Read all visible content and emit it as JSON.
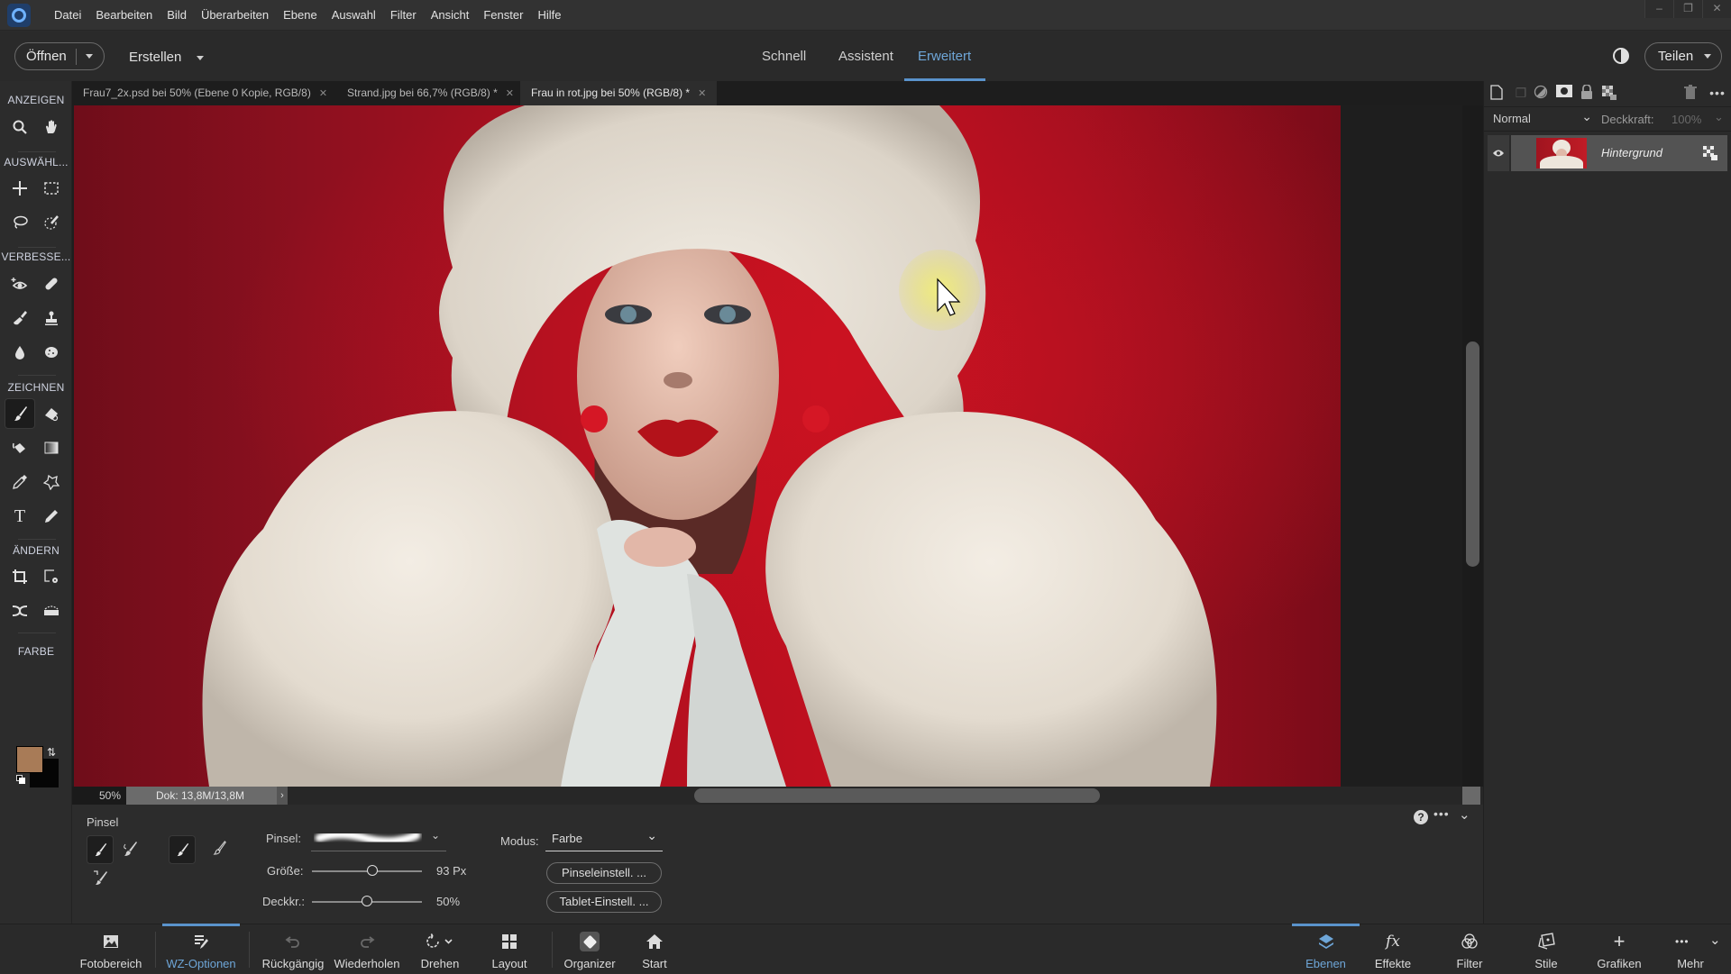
{
  "menu": {
    "items": [
      "Datei",
      "Bearbeiten",
      "Bild",
      "Überarbeiten",
      "Ebene",
      "Auswahl",
      "Filter",
      "Ansicht",
      "Fenster",
      "Hilfe"
    ],
    "window_controls": {
      "minimize": "–",
      "restore": "❐",
      "close": "✕"
    }
  },
  "topbar": {
    "open_label": "Öffnen",
    "create_label": "Erstellen",
    "modes": [
      "Schnell",
      "Assistent",
      "Erweitert"
    ],
    "active_mode": "Erweitert",
    "share_label": "Teilen"
  },
  "tabs": [
    {
      "label": "Frau7_2x.psd bei 50% (Ebene 0 Kopie, RGB/8)",
      "active": false
    },
    {
      "label": "Strand.jpg bei 66,7% (RGB/8) *",
      "active": false
    },
    {
      "label": "Frau in rot.jpg bei 50% (RGB/8) *",
      "active": true
    }
  ],
  "tools": {
    "sections": [
      "ANZEIGEN",
      "AUSWÄHL...",
      "VERBESSE...",
      "ZEICHNEN",
      "ÄNDERN",
      "FARBE"
    ],
    "items": [
      "zoom-tool",
      "hand-tool",
      "move-tool",
      "marquee-tool",
      "lasso-tool",
      "quick-selection-tool",
      "red-eye-tool",
      "spot-healing-tool",
      "smart-brush-tool",
      "clone-stamp-tool",
      "blur-tool",
      "sponge-tool",
      "brush-tool",
      "eraser-tool",
      "paint-bucket-tool",
      "gradient-tool",
      "eyedropper-tool",
      "custom-shape-tool",
      "type-tool",
      "pencil-tool",
      "crop-tool",
      "recompose-tool",
      "content-aware-move-tool",
      "straighten-tool"
    ],
    "active_tool": "brush-tool",
    "foreground_color": "#a87b57",
    "background_color": "#000000"
  },
  "status": {
    "zoom": "50%",
    "doc_size": "Dok: 13,8M/13,8M",
    "arrow": "›"
  },
  "options": {
    "tool_name": "Pinsel",
    "brush_label": "Pinsel:",
    "size_label": "Größe:",
    "size_value": "93 Px",
    "size_fraction": 0.55,
    "opacity_label": "Deckkr.:",
    "opacity_value": "50%",
    "opacity_fraction": 0.5,
    "mode_label": "Modus:",
    "mode_value": "Farbe",
    "brush_settings_btn": "Pinseleinstell. ...",
    "tablet_settings_btn": "Tablet-Einstell. ..."
  },
  "layers": {
    "blend_mode": "Normal",
    "opacity_label": "Deckkraft:",
    "opacity_value": "100%",
    "items": [
      {
        "name": "Hintergrund",
        "visible": true,
        "locked": true
      }
    ]
  },
  "bottombar": {
    "left": [
      {
        "label": "Fotobereich",
        "icon": "photo-bin-icon"
      },
      {
        "label": "WZ-Optionen",
        "icon": "tool-options-icon",
        "active": true
      },
      {
        "label": "Rückgängig",
        "icon": "undo-icon",
        "disabled": true
      },
      {
        "label": "Wiederholen",
        "icon": "redo-icon",
        "disabled": true
      },
      {
        "label": "Drehen",
        "icon": "rotate-icon"
      },
      {
        "label": "Layout",
        "icon": "layout-icon"
      },
      {
        "label": "Organizer",
        "icon": "organizer-icon"
      },
      {
        "label": "Start",
        "icon": "home-icon"
      }
    ],
    "right": [
      {
        "label": "Ebenen",
        "icon": "layers-icon",
        "active": true
      },
      {
        "label": "Effekte",
        "icon": "fx-icon"
      },
      {
        "label": "Filter",
        "icon": "filter-icon"
      },
      {
        "label": "Stile",
        "icon": "styles-icon"
      },
      {
        "label": "Grafiken",
        "icon": "plus-icon"
      },
      {
        "label": "Mehr",
        "icon": "more-icon"
      }
    ]
  },
  "accent_color": "#5a93cc"
}
